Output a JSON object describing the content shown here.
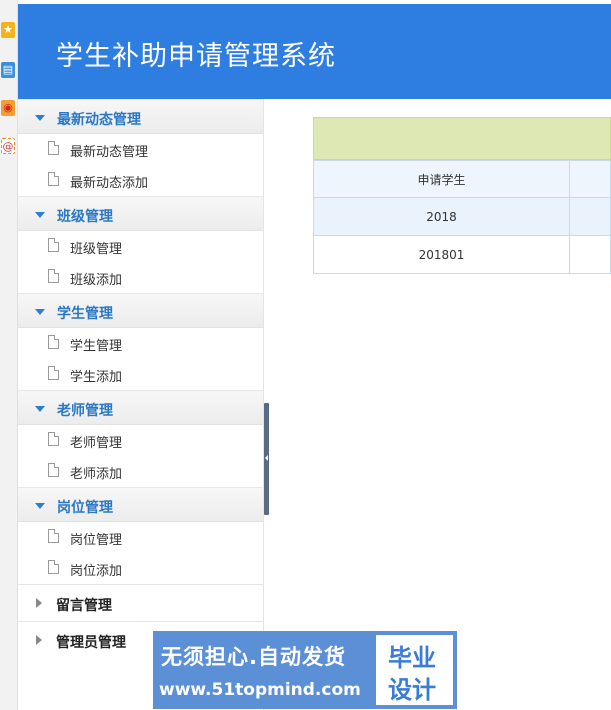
{
  "app": {
    "title": "学生补助申请管理系统"
  },
  "sidebar": {
    "groups": [
      {
        "label": "最新动态管理",
        "items": [
          {
            "label": "最新动态管理"
          },
          {
            "label": "最新动态添加"
          }
        ]
      },
      {
        "label": "班级管理",
        "items": [
          {
            "label": "班级管理"
          },
          {
            "label": "班级添加"
          }
        ]
      },
      {
        "label": "学生管理",
        "items": [
          {
            "label": "学生管理"
          },
          {
            "label": "学生添加"
          }
        ]
      },
      {
        "label": "老师管理",
        "items": [
          {
            "label": "老师管理"
          },
          {
            "label": "老师添加"
          }
        ]
      },
      {
        "label": "岗位管理",
        "items": [
          {
            "label": "岗位管理"
          },
          {
            "label": "岗位添加"
          }
        ]
      }
    ],
    "collapsed": [
      {
        "label": "留言管理"
      },
      {
        "label": "管理员管理"
      }
    ]
  },
  "table": {
    "headers": [
      "申请学生"
    ],
    "rows": [
      [
        "2018"
      ],
      [
        "201801"
      ]
    ]
  },
  "watermark": {
    "line1": "无须担心.自动发货",
    "line2": "www.51topmind.com",
    "badge_line1": "毕业",
    "badge_line2": "设计"
  },
  "colors": {
    "header": "#2e7de1",
    "accent": "#2b78c5",
    "panel": "#dde8b4"
  }
}
